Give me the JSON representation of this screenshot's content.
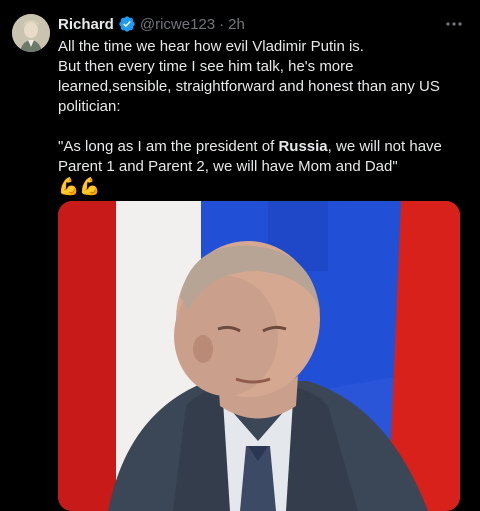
{
  "user": {
    "name": "Richard",
    "handle": "@ricwe123",
    "separator": "·",
    "time": "2h"
  },
  "tweet": {
    "lines": [
      "All the time we hear how evil Vladimir Putin is.",
      "But then every time I see him talk, he's more",
      "learned,sensible, straightforward and honest than any US",
      "politician:"
    ],
    "quote_line1_pre": "\"As long as I am the president of ",
    "quote_line1_bold": "Russia",
    "quote_line1_post": ", we will not have",
    "quote_line2": "Parent 1 and Parent 2, we will have Mom and Dad\"",
    "emoji": "💪💪"
  },
  "icons": {
    "verified": "verified-badge-icon",
    "more": "more-options-icon"
  },
  "colors": {
    "background": "#000000",
    "text": "#e7e9ea",
    "secondary_text": "#71767b",
    "verified_blue": "#1d9bf0",
    "flag_red": "#e2231b",
    "flag_blue": "#2150d6"
  }
}
